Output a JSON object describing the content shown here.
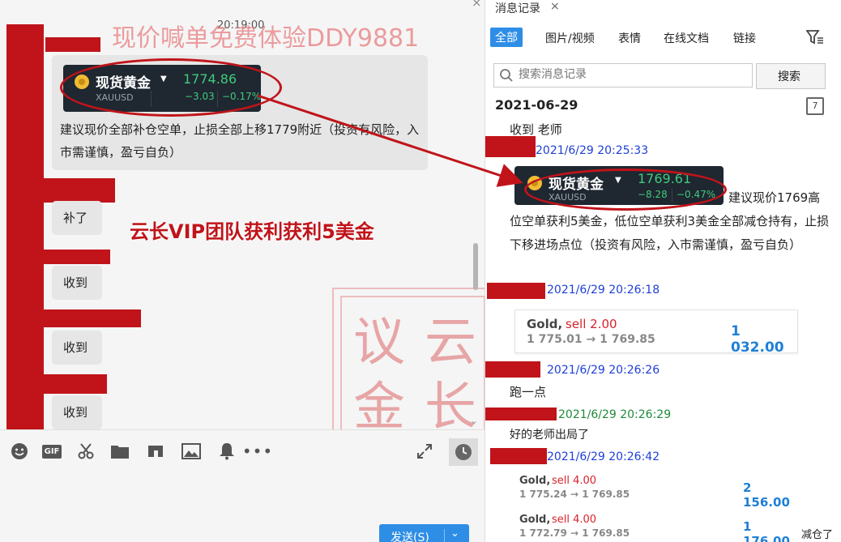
{
  "chat": {
    "top_time": "20:19:00",
    "watermark": "现价喊单免费体验DDY9881",
    "message": "建议现价全部补仓空单，止损全部上移1779附近（投资有风险，入市需谨慎，盈亏自负）",
    "quote": {
      "name": "现货黄金",
      "symbol": "XAUUSD",
      "price": "1774.86",
      "change": "−3.03",
      "change_pct": "−0.17%"
    },
    "replies": [
      "补了",
      "收到",
      "收到",
      "收到"
    ],
    "annotation": "云长VIP团队获利获利5美金",
    "stamp_chars": [
      "议",
      "云",
      "金",
      "长"
    ]
  },
  "toolbar": {
    "icons": [
      "emoji-icon",
      "gif-icon",
      "scissors-icon",
      "folder-icon",
      "quote-icon",
      "image-icon",
      "bell-icon",
      "more-icon"
    ],
    "gif_label": "GIF",
    "send_label": "发送(S)"
  },
  "history": {
    "title": "消息记录",
    "tabs": [
      "全部",
      "图片/视频",
      "表情",
      "在线文档",
      "链接"
    ],
    "search_placeholder": "搜索消息记录",
    "search_button": "搜索",
    "date": "2021-06-29",
    "calendar_day": "7",
    "entries": {
      "first_msg": "收到  老师",
      "ts1": "2021/6/29 20:25:33",
      "quote": {
        "name": "现货黄金",
        "symbol": "XAUUSD",
        "price": "1769.61",
        "change": "−8.28",
        "change_pct": "−0.47%"
      },
      "msg_inline_start": "建议现价1769高",
      "msg_rest": "位空单获利5美金，低位空单获利3美金全部减仓持有，止损下移进场点位（投资有风险，入市需谨慎，盈亏自负）",
      "ts2": "2021/6/29 20:26:18",
      "card1": {
        "title": "Gold,",
        "sell": "sell 2.00",
        "range": "1 775.01 → 1 769.85",
        "profit": "1 032.00"
      },
      "ts3": "2021/6/29 20:26:26",
      "msg3": "跑一点",
      "ts4": "2021/6/29 20:26:29",
      "msg4": "好的老师出局了",
      "ts5": "2021/6/29 20:26:42",
      "card2": {
        "title": "Gold,",
        "sell": "sell 4.00",
        "range": "1 775.24 → 1 769.85",
        "profit": "2 156.00"
      },
      "card3": {
        "title": "Gold,",
        "sell": "sell 4.00",
        "range": "1 772.79 → 1 769.85",
        "profit": "1 176.00"
      },
      "tail_text": "减仓了"
    }
  },
  "colors": {
    "accent": "#2e8ee6",
    "redaction": "#c0141a",
    "up_green": "#3ecb7b",
    "timestamp_blue": "#1f3fd6"
  }
}
